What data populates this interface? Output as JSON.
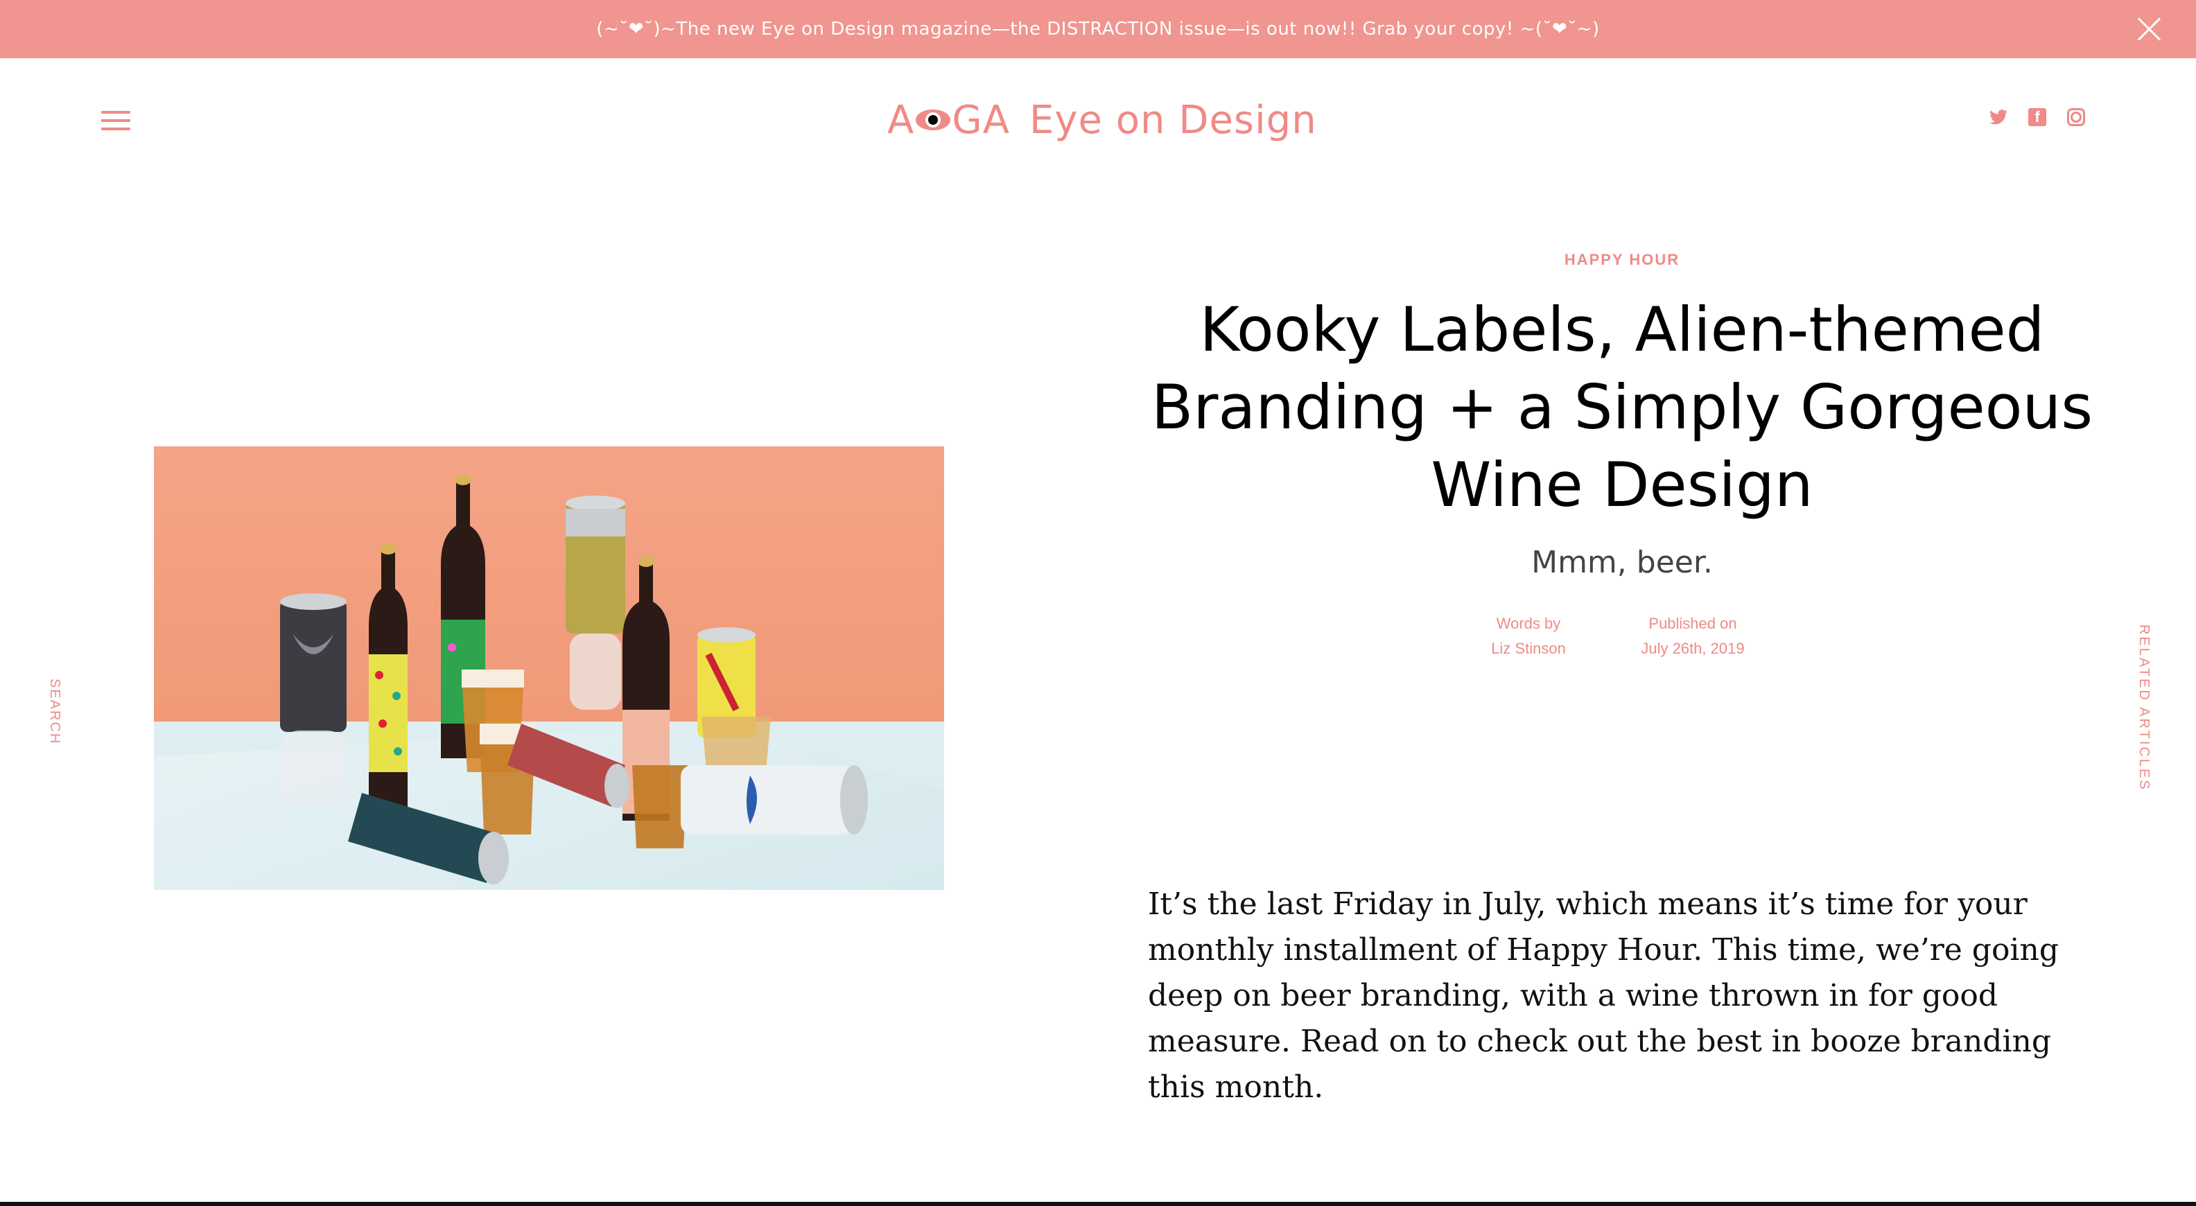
{
  "banner": {
    "text": "(~˘❤˘)~The new Eye on Design magazine—the DISTRACTION issue—is out now!! Grab your copy! ~(˘❤˘~)"
  },
  "header": {
    "logo_left": "A",
    "logo_right": "GA",
    "logo_name": "Eye on Design",
    "social": [
      "twitter-icon",
      "facebook-icon",
      "instagram-icon"
    ]
  },
  "side": {
    "search_label": "SEARCH",
    "related_label": "RELATED ARTICLES"
  },
  "article": {
    "category": "HAPPY HOUR",
    "title": "Kooky Labels, Alien-themed Branding + a Simply Gorgeous Wine Design",
    "dek": "Mmm, beer.",
    "byline_label": "Words by",
    "author": "Liz Stinson",
    "published_label": "Published on",
    "published_date": "July 26th, 2019",
    "intro": "It’s the last Friday in July, which means it’s time for your monthly installment of Happy Hour. This time, we’re going deep on beer branding, with a wine thrown in for good measure. Read on to check out the best in booze branding this month."
  },
  "colors": {
    "accent": "#ef8a86",
    "banner_bg": "#f0958f",
    "text": "#111111"
  }
}
